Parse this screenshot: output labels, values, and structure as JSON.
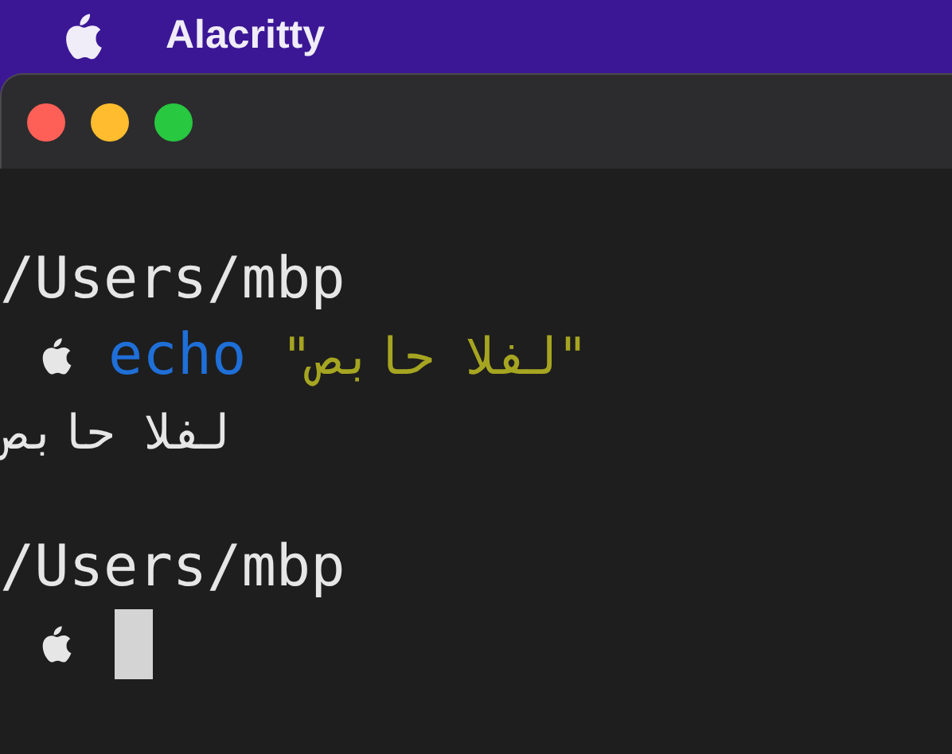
{
  "menu_bar": {
    "app_name": "Alacritty"
  },
  "window": {
    "traffic_lights": [
      {
        "kind": "close"
      },
      {
        "kind": "minimize"
      },
      {
        "kind": "zoom"
      }
    ]
  },
  "terminal": {
    "lines": [
      {
        "kind": "path",
        "text": "/Users/mbp"
      },
      {
        "kind": "command",
        "command": "echo",
        "argument": "\"صباح الفل\""
      },
      {
        "kind": "output",
        "text": "صباح الفل"
      },
      {
        "kind": "blank"
      },
      {
        "kind": "path",
        "text": "/Users/mbp"
      },
      {
        "kind": "prompt",
        "cursor": true
      }
    ]
  }
}
